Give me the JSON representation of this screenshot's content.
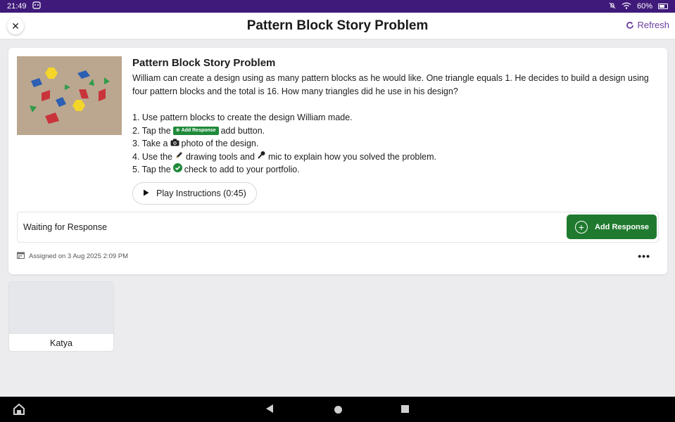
{
  "status_bar": {
    "time": "21:49",
    "battery": "60%"
  },
  "header": {
    "title": "Pattern Block Story Problem",
    "refresh_label": "Refresh"
  },
  "task": {
    "title": "Pattern Block Story Problem",
    "description": "William can create a design using as many pattern blocks as he would like. One triangle equals 1. He decides to build a design using four pattern blocks and the total is 16. How many triangles did he use in his design?",
    "steps": [
      {
        "prefix": "1. Use pattern blocks to create the design William made.",
        "suffix": ""
      },
      {
        "prefix": "2. Tap the",
        "chip": "Add Response",
        "suffix": "add button."
      },
      {
        "prefix": "3. Take a",
        "suffix": "photo of the design."
      },
      {
        "prefix": "4. Use the",
        "mid": "drawing tools and",
        "suffix": "mic to explain how you solved the problem."
      },
      {
        "prefix": "5. Tap the",
        "suffix": "check to add to your portfolio."
      }
    ],
    "play_label": "Play Instructions (0:45)"
  },
  "response": {
    "status": "Waiting for Response",
    "add_label": "Add Response"
  },
  "assigned": "Assigned on 3 Aug 2025 2:09 PM",
  "students": [
    {
      "name": "Katya"
    }
  ],
  "colors": {
    "accent": "#6b3fa0",
    "statusbar": "#3f1a7a",
    "green": "#1f7a2f"
  }
}
